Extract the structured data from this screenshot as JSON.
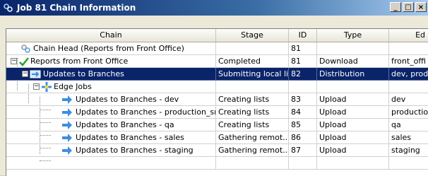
{
  "window": {
    "title": "Job 81 Chain Information",
    "buttons": [
      "_",
      "□",
      "×"
    ]
  },
  "columns": [
    "Chain",
    "Stage",
    "ID",
    "Type",
    "Ed"
  ],
  "rows": [
    {
      "chain": "Chain Head (Reports from Front Office)",
      "stage": "",
      "id": "81",
      "type": "",
      "ed": "",
      "icon": "chain-link-icon"
    },
    {
      "chain": "Reports from Front Office",
      "stage": "Completed",
      "id": "81",
      "type": "Download",
      "ed": "front_offi",
      "icon": "checkmark-icon"
    },
    {
      "chain": "Updates to Branches",
      "stage": "Submitting local list",
      "id": "82",
      "type": "Distribution",
      "ed": "dev, prod",
      "icon": "distribution-icon"
    },
    {
      "chain": "Edge Jobs",
      "stage": "",
      "id": "",
      "type": "",
      "ed": "",
      "icon": "edge-jobs-icon"
    },
    {
      "chain": "Updates to Branches - dev",
      "stage": "Creating lists",
      "id": "83",
      "type": "Upload",
      "ed": "dev",
      "icon": "arrow-right-icon"
    },
    {
      "chain": "Updates to Branches - production_srv",
      "stage": "Creating lists",
      "id": "84",
      "type": "Upload",
      "ed": "production",
      "icon": "arrow-right-icon"
    },
    {
      "chain": "Updates to Branches - qa",
      "stage": "Creating lists",
      "id": "85",
      "type": "Upload",
      "ed": "qa",
      "icon": "arrow-right-icon"
    },
    {
      "chain": "Updates to Branches - sales",
      "stage": "Gathering remot...",
      "id": "86",
      "type": "Upload",
      "ed": "sales",
      "icon": "arrow-right-icon"
    },
    {
      "chain": "Updates to Branches - staging",
      "stage": "Gathering remot...",
      "id": "87",
      "type": "Upload",
      "ed": "staging",
      "icon": "arrow-right-icon"
    }
  ],
  "toggles": {
    "expanded": "−"
  },
  "colors": {
    "selection": "#0a246a",
    "arrow": "#3c8fe0",
    "check": "#2aa12a"
  }
}
